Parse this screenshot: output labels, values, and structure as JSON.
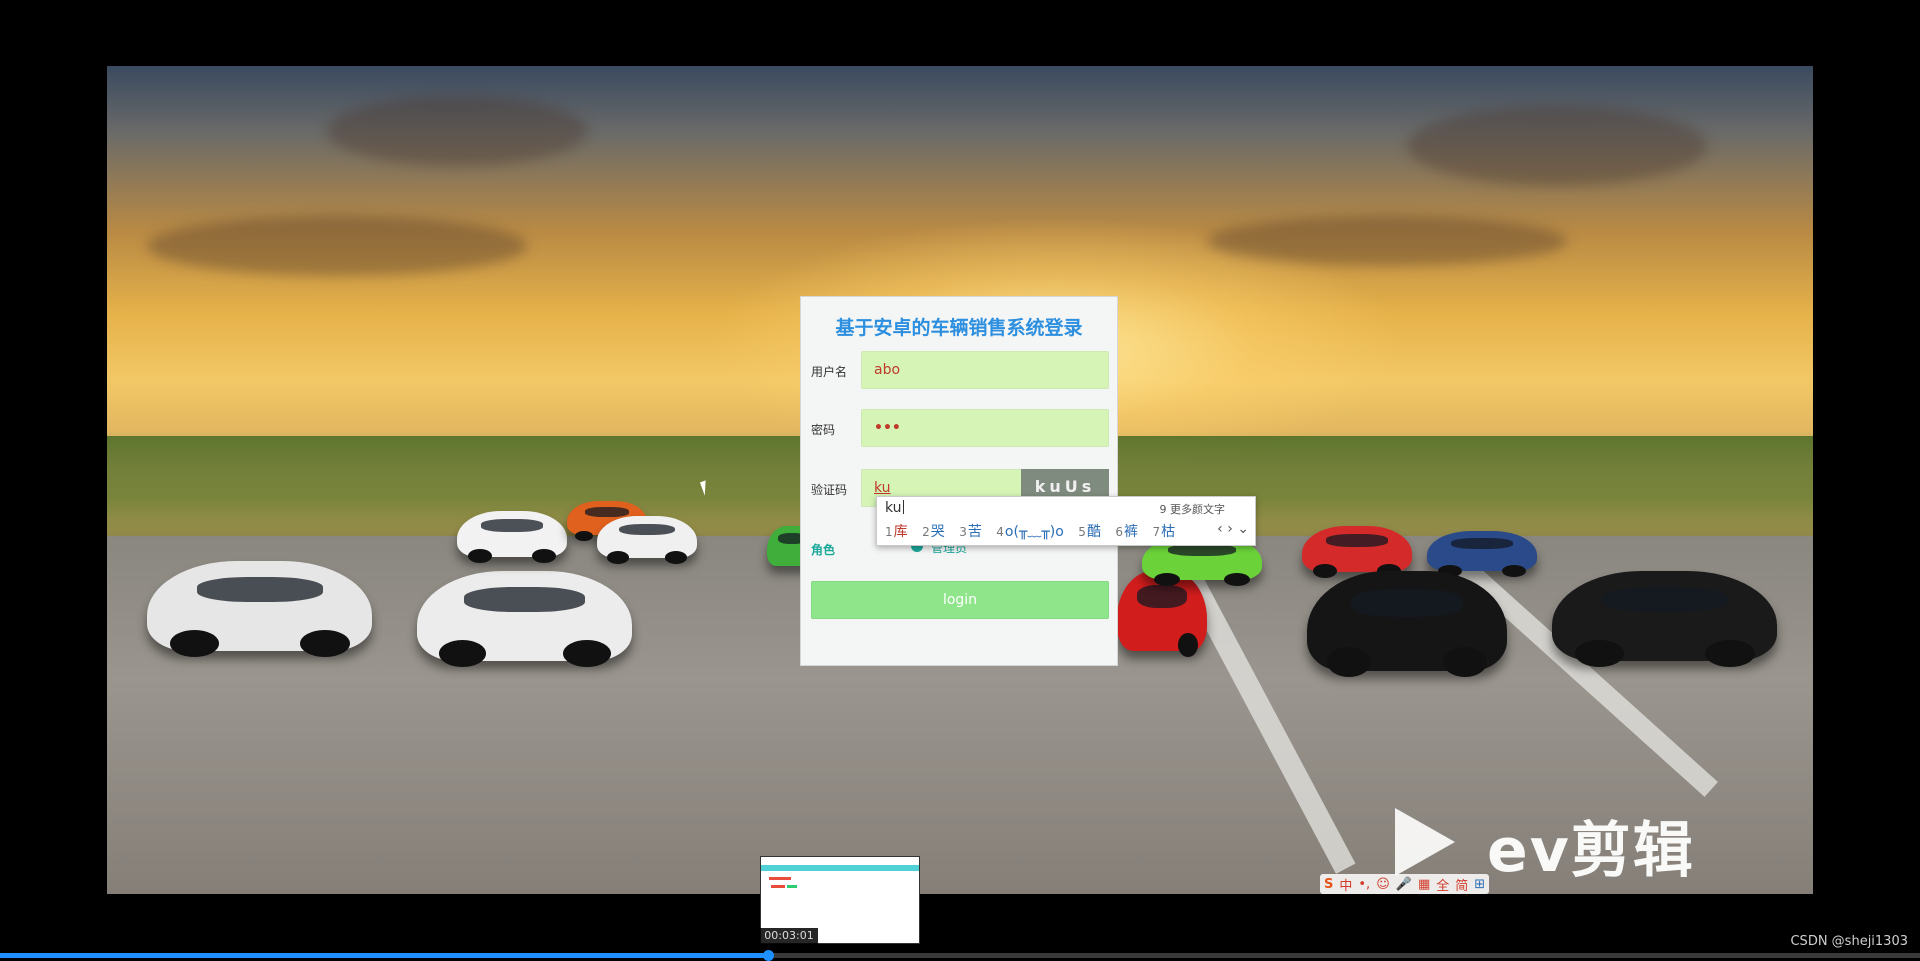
{
  "login": {
    "title": "基于安卓的车辆销售系统登录",
    "username_label": "用户名",
    "username_value": "abo",
    "password_label": "密码",
    "password_value": "•••",
    "captcha_label": "验证码",
    "captcha_value": "ku",
    "captcha_image_text": "kuUs",
    "role_label": "角色",
    "role_option": "管理员",
    "login_button": "login"
  },
  "ime": {
    "composition": "ku",
    "more_hint": "9 更多颜文字",
    "candidates": [
      {
        "num": "1",
        "text": "库"
      },
      {
        "num": "2",
        "text": "哭"
      },
      {
        "num": "3",
        "text": "苦"
      },
      {
        "num": "4",
        "text": "o(╥﹏╥)o"
      },
      {
        "num": "5",
        "text": "酷"
      },
      {
        "num": "6",
        "text": "裤"
      },
      {
        "num": "7",
        "text": "枯"
      }
    ],
    "nav": "‹ › ⌄"
  },
  "watermark": {
    "text": "ev剪辑"
  },
  "ime_toolbar": {
    "items": [
      "S",
      "中",
      "•,",
      "☺",
      "🎤",
      "▦",
      "全",
      "简",
      "⊞"
    ]
  },
  "player": {
    "timestamp": "00:03:01",
    "progress": 0.4
  },
  "credit": "CSDN @sheji1303"
}
